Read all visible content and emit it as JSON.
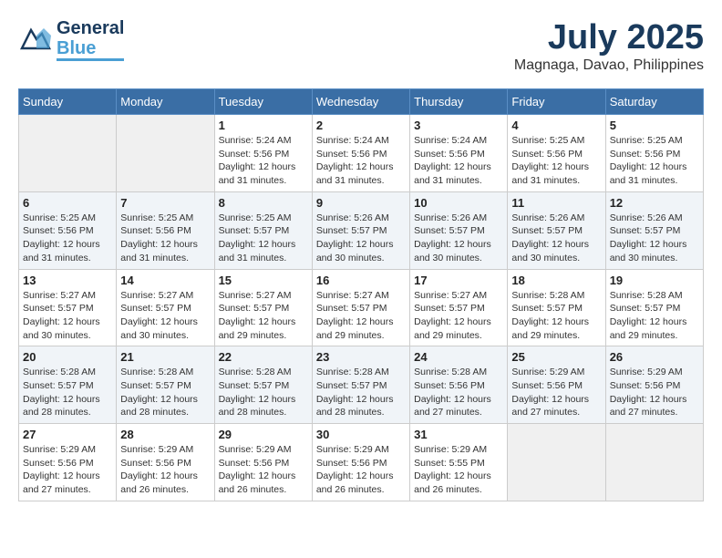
{
  "header": {
    "logo_line1": "General",
    "logo_line2": "Blue",
    "month_year": "July 2025",
    "location": "Magnaga, Davao, Philippines"
  },
  "calendar": {
    "days_of_week": [
      "Sunday",
      "Monday",
      "Tuesday",
      "Wednesday",
      "Thursday",
      "Friday",
      "Saturday"
    ],
    "weeks": [
      [
        {
          "day": "",
          "info": ""
        },
        {
          "day": "",
          "info": ""
        },
        {
          "day": "1",
          "info": "Sunrise: 5:24 AM\nSunset: 5:56 PM\nDaylight: 12 hours and 31 minutes."
        },
        {
          "day": "2",
          "info": "Sunrise: 5:24 AM\nSunset: 5:56 PM\nDaylight: 12 hours and 31 minutes."
        },
        {
          "day": "3",
          "info": "Sunrise: 5:24 AM\nSunset: 5:56 PM\nDaylight: 12 hours and 31 minutes."
        },
        {
          "day": "4",
          "info": "Sunrise: 5:25 AM\nSunset: 5:56 PM\nDaylight: 12 hours and 31 minutes."
        },
        {
          "day": "5",
          "info": "Sunrise: 5:25 AM\nSunset: 5:56 PM\nDaylight: 12 hours and 31 minutes."
        }
      ],
      [
        {
          "day": "6",
          "info": "Sunrise: 5:25 AM\nSunset: 5:56 PM\nDaylight: 12 hours and 31 minutes."
        },
        {
          "day": "7",
          "info": "Sunrise: 5:25 AM\nSunset: 5:56 PM\nDaylight: 12 hours and 31 minutes."
        },
        {
          "day": "8",
          "info": "Sunrise: 5:25 AM\nSunset: 5:57 PM\nDaylight: 12 hours and 31 minutes."
        },
        {
          "day": "9",
          "info": "Sunrise: 5:26 AM\nSunset: 5:57 PM\nDaylight: 12 hours and 30 minutes."
        },
        {
          "day": "10",
          "info": "Sunrise: 5:26 AM\nSunset: 5:57 PM\nDaylight: 12 hours and 30 minutes."
        },
        {
          "day": "11",
          "info": "Sunrise: 5:26 AM\nSunset: 5:57 PM\nDaylight: 12 hours and 30 minutes."
        },
        {
          "day": "12",
          "info": "Sunrise: 5:26 AM\nSunset: 5:57 PM\nDaylight: 12 hours and 30 minutes."
        }
      ],
      [
        {
          "day": "13",
          "info": "Sunrise: 5:27 AM\nSunset: 5:57 PM\nDaylight: 12 hours and 30 minutes."
        },
        {
          "day": "14",
          "info": "Sunrise: 5:27 AM\nSunset: 5:57 PM\nDaylight: 12 hours and 30 minutes."
        },
        {
          "day": "15",
          "info": "Sunrise: 5:27 AM\nSunset: 5:57 PM\nDaylight: 12 hours and 29 minutes."
        },
        {
          "day": "16",
          "info": "Sunrise: 5:27 AM\nSunset: 5:57 PM\nDaylight: 12 hours and 29 minutes."
        },
        {
          "day": "17",
          "info": "Sunrise: 5:27 AM\nSunset: 5:57 PM\nDaylight: 12 hours and 29 minutes."
        },
        {
          "day": "18",
          "info": "Sunrise: 5:28 AM\nSunset: 5:57 PM\nDaylight: 12 hours and 29 minutes."
        },
        {
          "day": "19",
          "info": "Sunrise: 5:28 AM\nSunset: 5:57 PM\nDaylight: 12 hours and 29 minutes."
        }
      ],
      [
        {
          "day": "20",
          "info": "Sunrise: 5:28 AM\nSunset: 5:57 PM\nDaylight: 12 hours and 28 minutes."
        },
        {
          "day": "21",
          "info": "Sunrise: 5:28 AM\nSunset: 5:57 PM\nDaylight: 12 hours and 28 minutes."
        },
        {
          "day": "22",
          "info": "Sunrise: 5:28 AM\nSunset: 5:57 PM\nDaylight: 12 hours and 28 minutes."
        },
        {
          "day": "23",
          "info": "Sunrise: 5:28 AM\nSunset: 5:57 PM\nDaylight: 12 hours and 28 minutes."
        },
        {
          "day": "24",
          "info": "Sunrise: 5:28 AM\nSunset: 5:56 PM\nDaylight: 12 hours and 27 minutes."
        },
        {
          "day": "25",
          "info": "Sunrise: 5:29 AM\nSunset: 5:56 PM\nDaylight: 12 hours and 27 minutes."
        },
        {
          "day": "26",
          "info": "Sunrise: 5:29 AM\nSunset: 5:56 PM\nDaylight: 12 hours and 27 minutes."
        }
      ],
      [
        {
          "day": "27",
          "info": "Sunrise: 5:29 AM\nSunset: 5:56 PM\nDaylight: 12 hours and 27 minutes."
        },
        {
          "day": "28",
          "info": "Sunrise: 5:29 AM\nSunset: 5:56 PM\nDaylight: 12 hours and 26 minutes."
        },
        {
          "day": "29",
          "info": "Sunrise: 5:29 AM\nSunset: 5:56 PM\nDaylight: 12 hours and 26 minutes."
        },
        {
          "day": "30",
          "info": "Sunrise: 5:29 AM\nSunset: 5:56 PM\nDaylight: 12 hours and 26 minutes."
        },
        {
          "day": "31",
          "info": "Sunrise: 5:29 AM\nSunset: 5:55 PM\nDaylight: 12 hours and 26 minutes."
        },
        {
          "day": "",
          "info": ""
        },
        {
          "day": "",
          "info": ""
        }
      ]
    ]
  }
}
